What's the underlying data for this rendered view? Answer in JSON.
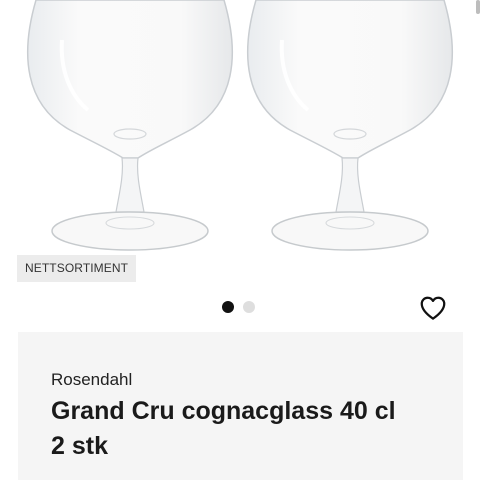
{
  "product": {
    "badge": "NETTSORTIMENT",
    "brand": "Rosendahl",
    "title": "Grand Cru cognacglass 40 cl 2 stk"
  },
  "gallery": {
    "image_count": 2,
    "active_index": 0
  },
  "icons": {
    "wishlist": "heart-outline-icon"
  },
  "colors": {
    "panel_background": "#f5f5f5",
    "badge_background": "#ececec",
    "active_dot": "#111111",
    "inactive_dot": "#dedede"
  }
}
